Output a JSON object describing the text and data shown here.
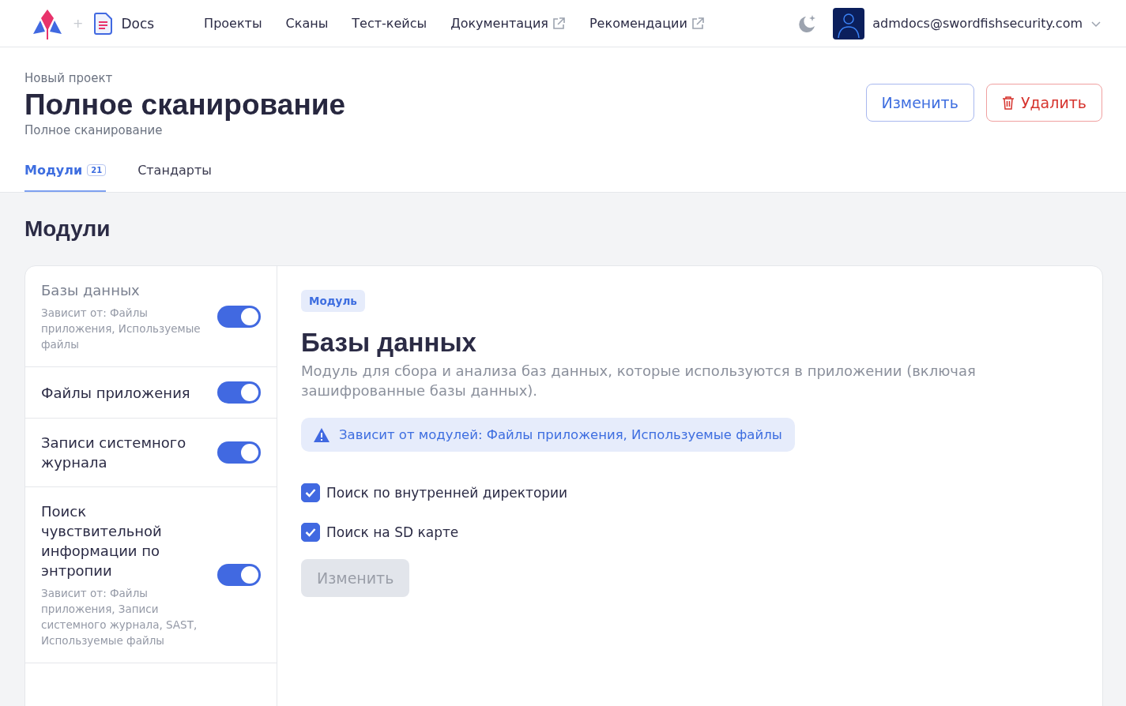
{
  "header": {
    "separator": "+",
    "product": "Docs",
    "nav": [
      {
        "label": "Проекты",
        "external": false
      },
      {
        "label": "Сканы",
        "external": false
      },
      {
        "label": "Тест-кейсы",
        "external": false
      },
      {
        "label": "Документация",
        "external": true
      },
      {
        "label": "Рекомендации",
        "external": true
      }
    ],
    "user": "admdocs@swordfishsecurity.com"
  },
  "page": {
    "breadcrumb": "Новый проект",
    "title": "Полное сканирование",
    "subtitle": "Полное сканирование",
    "actions": [
      {
        "label": "Изменить",
        "kind": "edit"
      },
      {
        "label": "Удалить",
        "kind": "delete"
      }
    ]
  },
  "tabs": [
    {
      "label": "Модули",
      "count": "21",
      "selected": true
    },
    {
      "label": "Стандарты",
      "selected": false
    }
  ],
  "section_title": "Модули",
  "modules": [
    {
      "name": "Базы данных",
      "depends": "Зависит от: Файлы приложения, Используемые файлы",
      "on": true,
      "selected": true
    },
    {
      "name": "Файлы приложения",
      "on": true,
      "selected": false
    },
    {
      "name": "Записи системного журнала",
      "on": true,
      "selected": false
    },
    {
      "name": "Поиск чувствительной информации по энтропии",
      "depends": "Зависит от: Файлы приложения, Записи системного журнала, SAST, Используемые файлы",
      "on": true,
      "selected": false
    }
  ],
  "detail": {
    "badge": "Модуль",
    "title": "Базы данных",
    "description": "Модуль для сбора и анализа баз данных, которые используются в приложении (включая зашифрованные базы данных).",
    "alert": "Зависит от модулей: Файлы приложения, Используемые файлы",
    "options": [
      {
        "label": "Поиск по внутренней директории",
        "checked": true
      },
      {
        "label": "Поиск на SD карте",
        "checked": true
      }
    ],
    "button": {
      "label": "Изменить",
      "disabled": true
    }
  }
}
